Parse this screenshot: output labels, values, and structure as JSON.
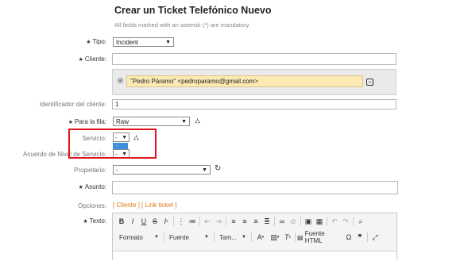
{
  "page": {
    "title": "Crear un Ticket Telefónico Nuevo",
    "mandatory_note": "All fields marked with an asterisk (*) are mandatory."
  },
  "form": {
    "tipo": {
      "label": "Tipo:",
      "value": "Incident"
    },
    "cliente": {
      "label": "Cliente:",
      "value": ""
    },
    "customer_selected": "\"Pedro Páramo\" <pedroparamo@gmail.com>",
    "identificador": {
      "label": "Identificador del cliente:",
      "value": "1"
    },
    "para_la_fila": {
      "label": "Para la fila:",
      "value": "Raw"
    },
    "servicio": {
      "label": "Servicio:",
      "value": "-",
      "dropdown_option": "-"
    },
    "acuerdo": {
      "label": "Acuerdo de Nivel de Servicio:",
      "value": "-"
    },
    "propietario": {
      "label": "Propietario:",
      "value": "-"
    },
    "asunto": {
      "label": "Asunto:",
      "value": ""
    },
    "opciones": {
      "label": "Opciones:",
      "links": "[ Cliente ] [ Link ticket ]"
    },
    "texto": {
      "label": "Texto:"
    }
  },
  "editor": {
    "row1": [
      "B",
      "I",
      "U",
      "S",
      "Ix",
      "list-ol",
      "list-ul",
      "outdent",
      "indent",
      "align-left",
      "align-center",
      "align-right",
      "align-justify",
      "link",
      "unlink",
      "image",
      "table",
      "undo",
      "redo",
      "search"
    ],
    "formato": "Formato",
    "fuente": "Fuente",
    "tamano": "Tam...",
    "fuente_html": "Fuente HTML",
    "icons": {
      "tree": "tree-icon",
      "refresh": "refresh-icon",
      "minus": "remove-icon"
    }
  },
  "colors": {
    "highlight": "#e0141d",
    "link": "#e1791a",
    "chip": "#fbeab3",
    "dropdown_selected": "#3d8fe0"
  }
}
